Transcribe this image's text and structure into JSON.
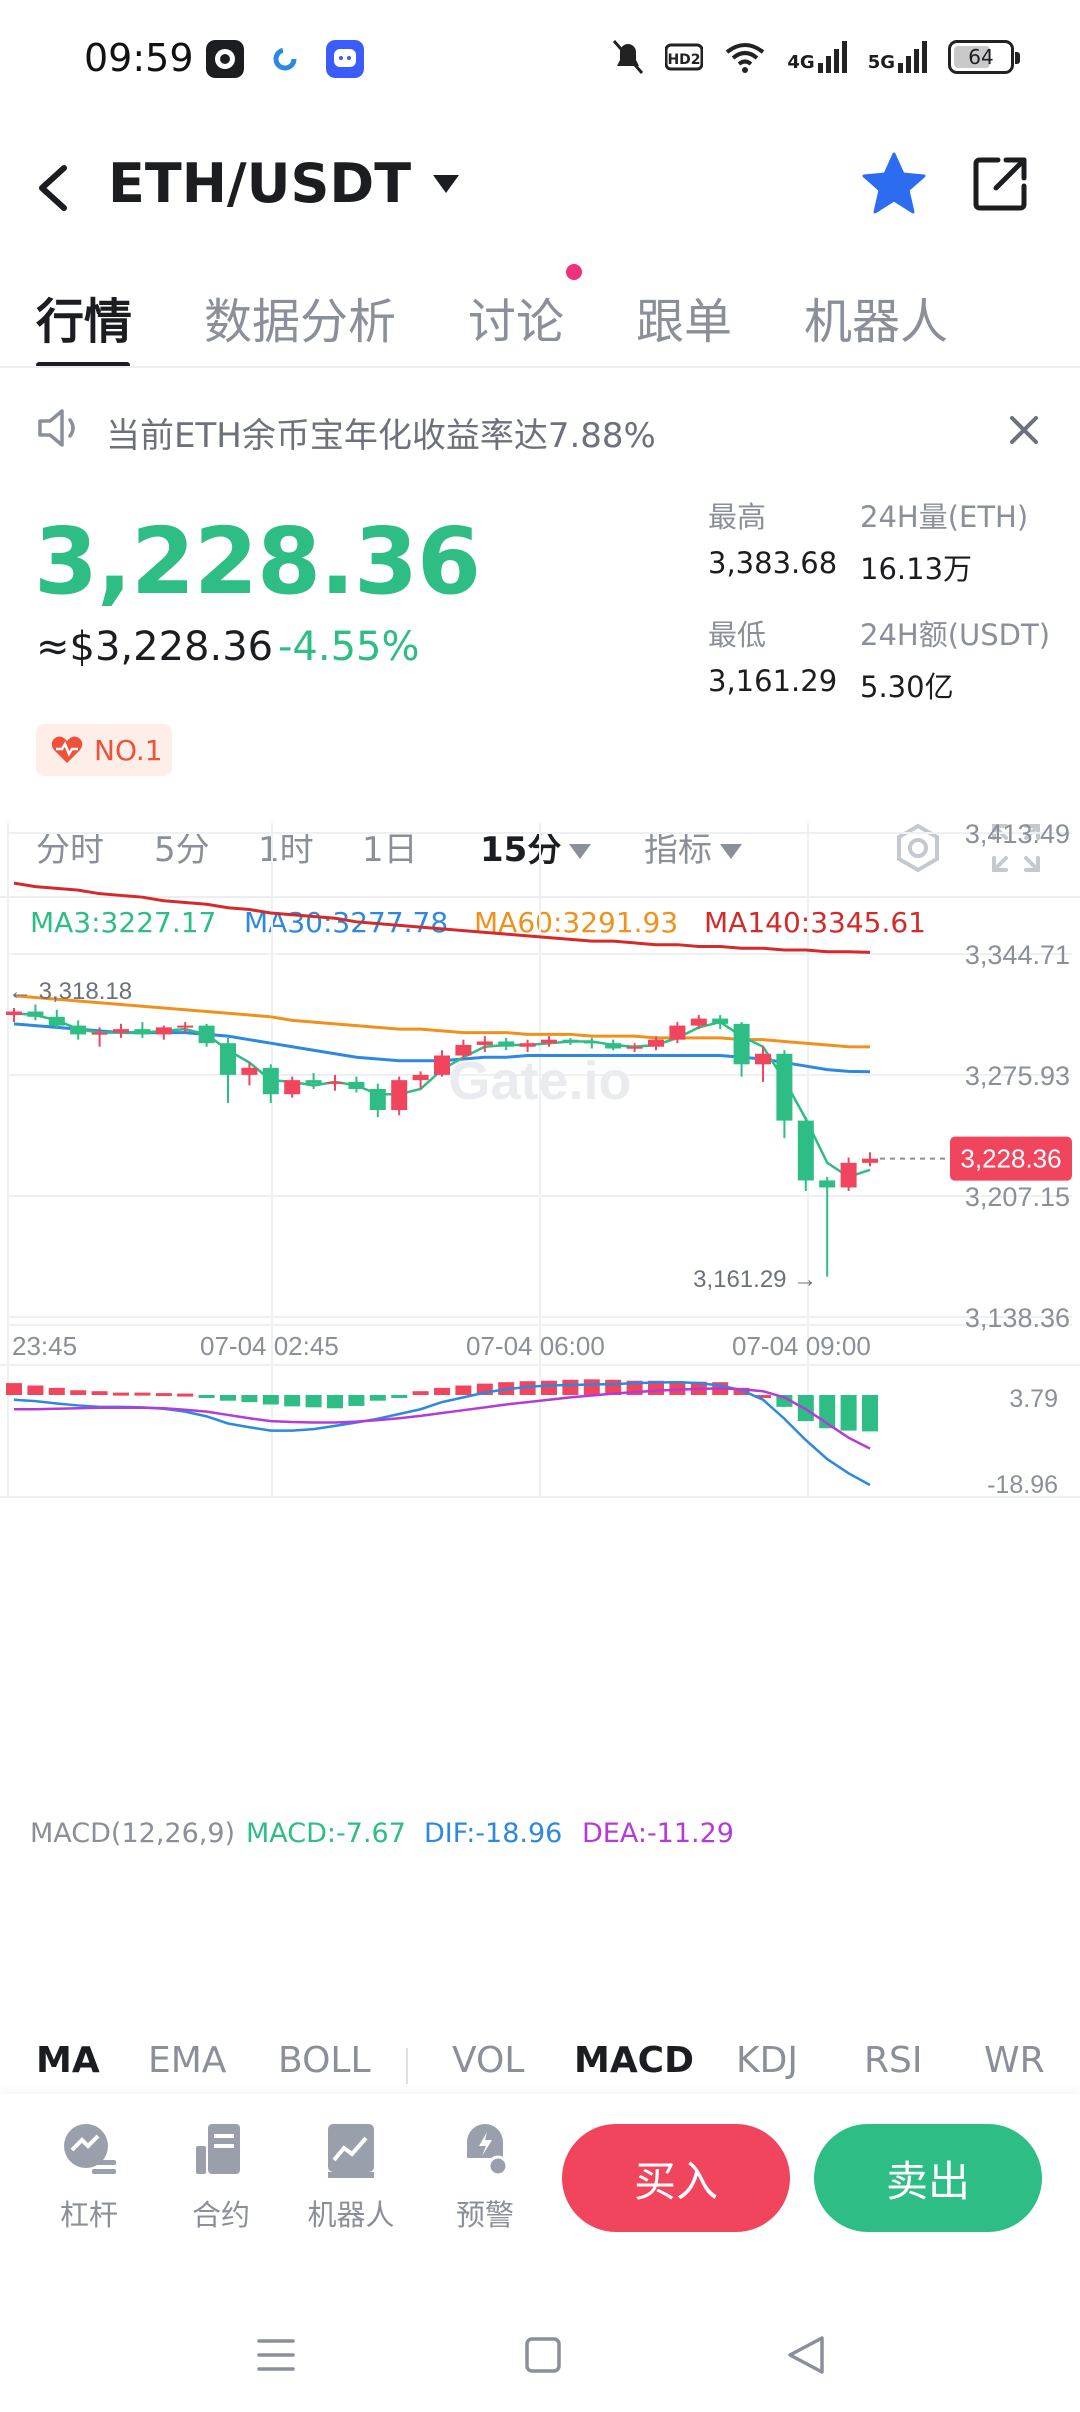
{
  "status_bar": {
    "time": "09:59",
    "network_4g": "4G",
    "network_5g": "5G",
    "hd_label": "HD2",
    "battery": "64"
  },
  "header": {
    "pair": "ETH/USDT"
  },
  "tabs": [
    {
      "label": "行情",
      "active": true
    },
    {
      "label": "数据分析",
      "active": false
    },
    {
      "label": "讨论",
      "active": false
    },
    {
      "label": "跟单",
      "active": false
    },
    {
      "label": "机器人",
      "active": false
    }
  ],
  "announcement": {
    "text": "当前ETH余币宝年化收益率达7.88%"
  },
  "price": {
    "last": "3,228.36",
    "usd": "≈$3,228.36",
    "change": "-4.55%",
    "badge": "NO.1"
  },
  "stats": {
    "high_label": "最高",
    "high_value": "3,383.68",
    "low_label": "最低",
    "low_value": "3,161.29",
    "vol_label": "24H量(ETH)",
    "vol_value": "16.13万",
    "amount_label": "24H额(USDT)",
    "amount_value": "5.30亿"
  },
  "intervals": [
    {
      "label": "分时",
      "active": false
    },
    {
      "label": "5分",
      "active": false
    },
    {
      "label": "1时",
      "active": false
    },
    {
      "label": "1日",
      "active": false
    },
    {
      "label": "15分",
      "active": true
    },
    {
      "label": "指标",
      "active": false
    }
  ],
  "ma_legend": {
    "ma3": "MA3:3227.17",
    "ma30": "MA30:3277.78",
    "ma60": "MA60:3291.93",
    "ma140": "MA140:3345.61"
  },
  "macd_legend": {
    "title": "MACD(12,26,9)",
    "macd": "MACD:-7.67",
    "dif": "DIF:-18.96",
    "dea": "DEA:-11.29",
    "top": "3.79",
    "bottom": "-18.96"
  },
  "indicator_tabs": [
    {
      "label": "MA",
      "active": true
    },
    {
      "label": "EMA",
      "active": false
    },
    {
      "label": "BOLL",
      "active": false
    },
    {
      "label": "VOL",
      "active": false
    },
    {
      "label": "MACD",
      "active": true
    },
    {
      "label": "KDJ",
      "active": false
    },
    {
      "label": "RSI",
      "active": false
    },
    {
      "label": "WR",
      "active": false
    }
  ],
  "actions": {
    "leverage": "杠杆",
    "futures": "合约",
    "bot": "机器人",
    "alert": "预警",
    "buy": "买入",
    "sell": "卖出"
  },
  "chart_data": {
    "type": "candlestick",
    "y_axis_labels": [
      "3,413.49",
      "3,344.71",
      "3,275.93",
      "3,207.15",
      "3,138.36"
    ],
    "ylim": [
      3138.36,
      3413.49
    ],
    "x_axis_labels": [
      "23:45",
      "07-04 02:45",
      "07-04 06:00",
      "07-04 09:00"
    ],
    "current_price_label": "3,228.36",
    "high_marker": "3,318.18",
    "low_marker": "3,161.29",
    "watermark": "Gate.io",
    "colors": {
      "up": "#2dbd85",
      "down": "#f0455d",
      "ma3": "#2dbd85",
      "ma30": "#2d88e0",
      "ma60": "#f0911e",
      "ma140": "#d42a2a"
    },
    "candles": [
      {
        "o": 3310,
        "h": 3314,
        "l": 3306,
        "c": 3312
      },
      {
        "o": 3312,
        "h": 3316,
        "l": 3307,
        "c": 3309
      },
      {
        "o": 3309,
        "h": 3313,
        "l": 3302,
        "c": 3304
      },
      {
        "o": 3304,
        "h": 3307,
        "l": 3296,
        "c": 3299
      },
      {
        "o": 3299,
        "h": 3303,
        "l": 3292,
        "c": 3300
      },
      {
        "o": 3300,
        "h": 3305,
        "l": 3297,
        "c": 3302
      },
      {
        "o": 3302,
        "h": 3306,
        "l": 3297,
        "c": 3299
      },
      {
        "o": 3299,
        "h": 3304,
        "l": 3296,
        "c": 3303
      },
      {
        "o": 3303,
        "h": 3306,
        "l": 3300,
        "c": 3304
      },
      {
        "o": 3304,
        "h": 3305,
        "l": 3292,
        "c": 3294
      },
      {
        "o": 3294,
        "h": 3297,
        "l": 3260,
        "c": 3276
      },
      {
        "o": 3276,
        "h": 3283,
        "l": 3270,
        "c": 3280
      },
      {
        "o": 3280,
        "h": 3282,
        "l": 3260,
        "c": 3265
      },
      {
        "o": 3265,
        "h": 3275,
        "l": 3263,
        "c": 3273
      },
      {
        "o": 3273,
        "h": 3277,
        "l": 3268,
        "c": 3271
      },
      {
        "o": 3271,
        "h": 3276,
        "l": 3267,
        "c": 3272
      },
      {
        "o": 3272,
        "h": 3275,
        "l": 3266,
        "c": 3268
      },
      {
        "o": 3268,
        "h": 3271,
        "l": 3252,
        "c": 3256
      },
      {
        "o": 3256,
        "h": 3275,
        "l": 3253,
        "c": 3273
      },
      {
        "o": 3273,
        "h": 3278,
        "l": 3268,
        "c": 3276
      },
      {
        "o": 3276,
        "h": 3290,
        "l": 3275,
        "c": 3287
      },
      {
        "o": 3287,
        "h": 3296,
        "l": 3285,
        "c": 3293
      },
      {
        "o": 3293,
        "h": 3298,
        "l": 3289,
        "c": 3295
      },
      {
        "o": 3295,
        "h": 3297,
        "l": 3290,
        "c": 3292
      },
      {
        "o": 3292,
        "h": 3296,
        "l": 3289,
        "c": 3294
      },
      {
        "o": 3294,
        "h": 3298,
        "l": 3292,
        "c": 3296
      },
      {
        "o": 3296,
        "h": 3297,
        "l": 3293,
        "c": 3295
      },
      {
        "o": 3295,
        "h": 3297,
        "l": 3291,
        "c": 3294
      },
      {
        "o": 3294,
        "h": 3296,
        "l": 3290,
        "c": 3291
      },
      {
        "o": 3291,
        "h": 3294,
        "l": 3289,
        "c": 3292
      },
      {
        "o": 3292,
        "h": 3298,
        "l": 3290,
        "c": 3296
      },
      {
        "o": 3296,
        "h": 3306,
        "l": 3294,
        "c": 3304
      },
      {
        "o": 3304,
        "h": 3310,
        "l": 3302,
        "c": 3308
      },
      {
        "o": 3308,
        "h": 3310,
        "l": 3302,
        "c": 3305
      },
      {
        "o": 3305,
        "h": 3306,
        "l": 3275,
        "c": 3282
      },
      {
        "o": 3282,
        "h": 3292,
        "l": 3272,
        "c": 3288
      },
      {
        "o": 3288,
        "h": 3290,
        "l": 3240,
        "c": 3250
      },
      {
        "o": 3250,
        "h": 3252,
        "l": 3210,
        "c": 3216
      },
      {
        "o": 3216,
        "h": 3218,
        "l": 3161.29,
        "c": 3212
      },
      {
        "o": 3212,
        "h": 3229,
        "l": 3210,
        "c": 3226
      },
      {
        "o": 3226,
        "h": 3232,
        "l": 3224,
        "c": 3228.36
      }
    ],
    "ma3": [
      3311,
      3310,
      3307,
      3302,
      3300,
      3300,
      3300,
      3301,
      3302,
      3299,
      3290,
      3283,
      3273,
      3272,
      3270,
      3272,
      3270,
      3265,
      3265,
      3268,
      3279,
      3286,
      3292,
      3293,
      3293,
      3294,
      3295,
      3295,
      3293,
      3292,
      3293,
      3297,
      3303,
      3306,
      3298,
      3292,
      3273,
      3251,
      3226,
      3218,
      3222
    ],
    "ma30": [
      3305,
      3304,
      3303,
      3302,
      3301,
      3300,
      3300,
      3300,
      3300,
      3299,
      3298,
      3296,
      3294,
      3292,
      3290,
      3288,
      3286,
      3285,
      3284,
      3284,
      3284,
      3285,
      3286,
      3286,
      3287,
      3287,
      3287,
      3287,
      3287,
      3287,
      3287,
      3287,
      3287,
      3287,
      3286,
      3285,
      3283,
      3281,
      3279,
      3278,
      3277.78
    ],
    "ma60": [
      3321,
      3320,
      3319,
      3318,
      3317,
      3316,
      3315,
      3314,
      3313,
      3312,
      3311,
      3310,
      3309,
      3307,
      3306,
      3305,
      3304,
      3303,
      3302,
      3302,
      3301,
      3300,
      3300,
      3300,
      3299,
      3299,
      3299,
      3298,
      3298,
      3298,
      3297,
      3297,
      3297,
      3297,
      3296,
      3296,
      3295,
      3294,
      3293,
      3292,
      3291.93
    ],
    "ma140": [
      3385,
      3383,
      3382,
      3381,
      3379,
      3378,
      3377,
      3375,
      3374,
      3373,
      3371,
      3370,
      3368,
      3367,
      3366,
      3365,
      3363,
      3362,
      3361,
      3360,
      3359,
      3358,
      3357,
      3356,
      3355,
      3354,
      3353,
      3352,
      3352,
      3351,
      3350,
      3350,
      3349,
      3349,
      3348,
      3348,
      3347,
      3347,
      3346,
      3346,
      3345.61
    ],
    "macd_hist": [
      2.5,
      2.0,
      1.5,
      1.0,
      0.8,
      0.5,
      0.5,
      0.4,
      0.3,
      -0.3,
      -1.2,
      -1.5,
      -2.0,
      -2.4,
      -2.6,
      -2.8,
      -2.3,
      -1.2,
      -0.5,
      0.8,
      1.5,
      2.0,
      2.4,
      2.7,
      2.9,
      3.0,
      3.2,
      3.3,
      3.2,
      3.0,
      3.0,
      2.9,
      2.8,
      2.7,
      1.5,
      0,
      -2.5,
      -5.5,
      -7.0,
      -7.5,
      -7.67
    ],
    "dif": [
      -1.0,
      -1.3,
      -1.8,
      -2.2,
      -2.5,
      -2.5,
      -2.6,
      -2.9,
      -3.5,
      -4.5,
      -6.0,
      -6.8,
      -7.5,
      -7.5,
      -7.2,
      -6.5,
      -5.8,
      -5.0,
      -4.0,
      -3.0,
      -1.5,
      -0.5,
      0.5,
      1.2,
      1.7,
      2.0,
      2.1,
      2.2,
      2.3,
      2.5,
      2.6,
      2.7,
      2.5,
      2.0,
      1.0,
      -1.0,
      -5.0,
      -9.5,
      -13.5,
      -16.5,
      -18.96
    ],
    "dea": [
      -3.0,
      -3.0,
      -2.9,
      -2.8,
      -2.7,
      -2.7,
      -2.7,
      -2.8,
      -3.1,
      -3.5,
      -4.2,
      -4.9,
      -5.5,
      -5.7,
      -5.8,
      -5.8,
      -5.6,
      -5.3,
      -4.9,
      -4.4,
      -3.8,
      -3.2,
      -2.6,
      -2.0,
      -1.5,
      -1.0,
      -0.5,
      -0.1,
      0.3,
      0.6,
      0.9,
      1.1,
      1.3,
      1.4,
      1.2,
      0.8,
      -0.5,
      -3.0,
      -6.0,
      -9.0,
      -11.29
    ],
    "macd_ylim": [
      -18.96,
      3.79
    ]
  }
}
